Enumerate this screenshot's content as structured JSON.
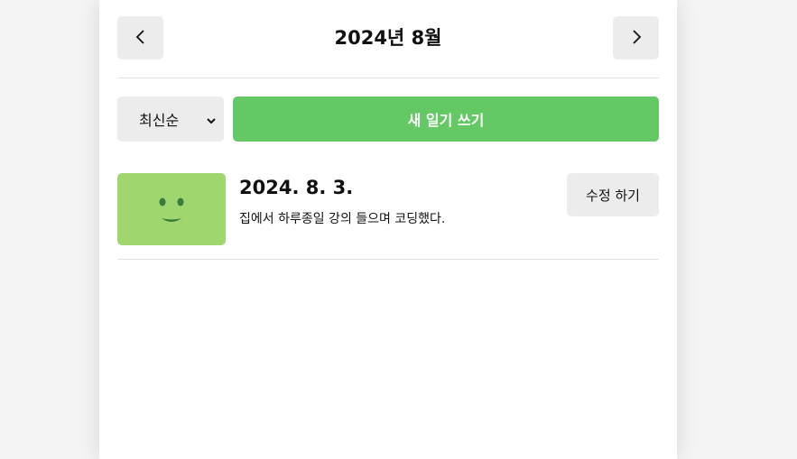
{
  "header": {
    "title": "2024년 8월",
    "prev_label": "<",
    "next_label": ">"
  },
  "menu": {
    "sort_selected": "최신순",
    "new_button_label": "새 일기 쓰기"
  },
  "diaries": [
    {
      "date": "2024. 8. 3.",
      "content": "집에서 하루종일 강의 들으며 코딩했다.",
      "emotion_icon": "smiling-face-icon",
      "emotion_color": "#9fd66e",
      "edit_label": "수정 하기"
    }
  ],
  "colors": {
    "accent": "#64c964",
    "button_gray": "#ececec",
    "background": "#f4f4f4"
  }
}
